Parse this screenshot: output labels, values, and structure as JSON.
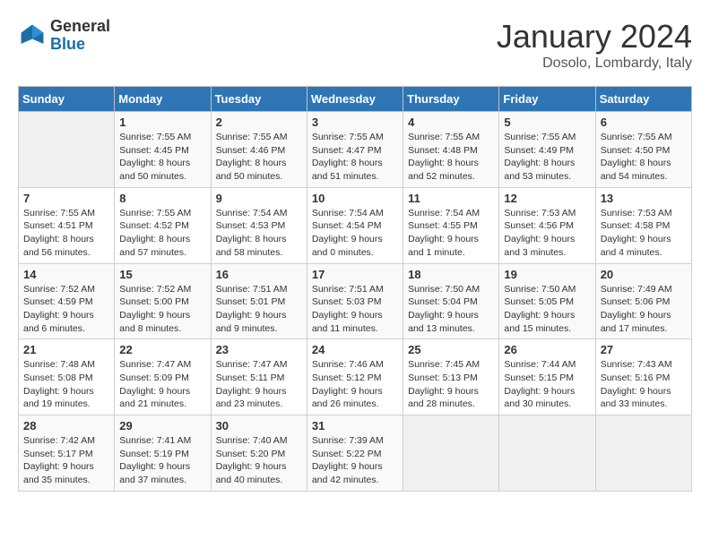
{
  "logo": {
    "general": "General",
    "blue": "Blue"
  },
  "header": {
    "title": "January 2024",
    "subtitle": "Dosolo, Lombardy, Italy"
  },
  "columns": [
    "Sunday",
    "Monday",
    "Tuesday",
    "Wednesday",
    "Thursday",
    "Friday",
    "Saturday"
  ],
  "weeks": [
    [
      {
        "day": "",
        "sunrise": "",
        "sunset": "",
        "daylight": ""
      },
      {
        "day": "1",
        "sunrise": "Sunrise: 7:55 AM",
        "sunset": "Sunset: 4:45 PM",
        "daylight": "Daylight: 8 hours and 50 minutes."
      },
      {
        "day": "2",
        "sunrise": "Sunrise: 7:55 AM",
        "sunset": "Sunset: 4:46 PM",
        "daylight": "Daylight: 8 hours and 50 minutes."
      },
      {
        "day": "3",
        "sunrise": "Sunrise: 7:55 AM",
        "sunset": "Sunset: 4:47 PM",
        "daylight": "Daylight: 8 hours and 51 minutes."
      },
      {
        "day": "4",
        "sunrise": "Sunrise: 7:55 AM",
        "sunset": "Sunset: 4:48 PM",
        "daylight": "Daylight: 8 hours and 52 minutes."
      },
      {
        "day": "5",
        "sunrise": "Sunrise: 7:55 AM",
        "sunset": "Sunset: 4:49 PM",
        "daylight": "Daylight: 8 hours and 53 minutes."
      },
      {
        "day": "6",
        "sunrise": "Sunrise: 7:55 AM",
        "sunset": "Sunset: 4:50 PM",
        "daylight": "Daylight: 8 hours and 54 minutes."
      }
    ],
    [
      {
        "day": "7",
        "sunrise": "Sunrise: 7:55 AM",
        "sunset": "Sunset: 4:51 PM",
        "daylight": "Daylight: 8 hours and 56 minutes."
      },
      {
        "day": "8",
        "sunrise": "Sunrise: 7:55 AM",
        "sunset": "Sunset: 4:52 PM",
        "daylight": "Daylight: 8 hours and 57 minutes."
      },
      {
        "day": "9",
        "sunrise": "Sunrise: 7:54 AM",
        "sunset": "Sunset: 4:53 PM",
        "daylight": "Daylight: 8 hours and 58 minutes."
      },
      {
        "day": "10",
        "sunrise": "Sunrise: 7:54 AM",
        "sunset": "Sunset: 4:54 PM",
        "daylight": "Daylight: 9 hours and 0 minutes."
      },
      {
        "day": "11",
        "sunrise": "Sunrise: 7:54 AM",
        "sunset": "Sunset: 4:55 PM",
        "daylight": "Daylight: 9 hours and 1 minute."
      },
      {
        "day": "12",
        "sunrise": "Sunrise: 7:53 AM",
        "sunset": "Sunset: 4:56 PM",
        "daylight": "Daylight: 9 hours and 3 minutes."
      },
      {
        "day": "13",
        "sunrise": "Sunrise: 7:53 AM",
        "sunset": "Sunset: 4:58 PM",
        "daylight": "Daylight: 9 hours and 4 minutes."
      }
    ],
    [
      {
        "day": "14",
        "sunrise": "Sunrise: 7:52 AM",
        "sunset": "Sunset: 4:59 PM",
        "daylight": "Daylight: 9 hours and 6 minutes."
      },
      {
        "day": "15",
        "sunrise": "Sunrise: 7:52 AM",
        "sunset": "Sunset: 5:00 PM",
        "daylight": "Daylight: 9 hours and 8 minutes."
      },
      {
        "day": "16",
        "sunrise": "Sunrise: 7:51 AM",
        "sunset": "Sunset: 5:01 PM",
        "daylight": "Daylight: 9 hours and 9 minutes."
      },
      {
        "day": "17",
        "sunrise": "Sunrise: 7:51 AM",
        "sunset": "Sunset: 5:03 PM",
        "daylight": "Daylight: 9 hours and 11 minutes."
      },
      {
        "day": "18",
        "sunrise": "Sunrise: 7:50 AM",
        "sunset": "Sunset: 5:04 PM",
        "daylight": "Daylight: 9 hours and 13 minutes."
      },
      {
        "day": "19",
        "sunrise": "Sunrise: 7:50 AM",
        "sunset": "Sunset: 5:05 PM",
        "daylight": "Daylight: 9 hours and 15 minutes."
      },
      {
        "day": "20",
        "sunrise": "Sunrise: 7:49 AM",
        "sunset": "Sunset: 5:06 PM",
        "daylight": "Daylight: 9 hours and 17 minutes."
      }
    ],
    [
      {
        "day": "21",
        "sunrise": "Sunrise: 7:48 AM",
        "sunset": "Sunset: 5:08 PM",
        "daylight": "Daylight: 9 hours and 19 minutes."
      },
      {
        "day": "22",
        "sunrise": "Sunrise: 7:47 AM",
        "sunset": "Sunset: 5:09 PM",
        "daylight": "Daylight: 9 hours and 21 minutes."
      },
      {
        "day": "23",
        "sunrise": "Sunrise: 7:47 AM",
        "sunset": "Sunset: 5:11 PM",
        "daylight": "Daylight: 9 hours and 23 minutes."
      },
      {
        "day": "24",
        "sunrise": "Sunrise: 7:46 AM",
        "sunset": "Sunset: 5:12 PM",
        "daylight": "Daylight: 9 hours and 26 minutes."
      },
      {
        "day": "25",
        "sunrise": "Sunrise: 7:45 AM",
        "sunset": "Sunset: 5:13 PM",
        "daylight": "Daylight: 9 hours and 28 minutes."
      },
      {
        "day": "26",
        "sunrise": "Sunrise: 7:44 AM",
        "sunset": "Sunset: 5:15 PM",
        "daylight": "Daylight: 9 hours and 30 minutes."
      },
      {
        "day": "27",
        "sunrise": "Sunrise: 7:43 AM",
        "sunset": "Sunset: 5:16 PM",
        "daylight": "Daylight: 9 hours and 33 minutes."
      }
    ],
    [
      {
        "day": "28",
        "sunrise": "Sunrise: 7:42 AM",
        "sunset": "Sunset: 5:17 PM",
        "daylight": "Daylight: 9 hours and 35 minutes."
      },
      {
        "day": "29",
        "sunrise": "Sunrise: 7:41 AM",
        "sunset": "Sunset: 5:19 PM",
        "daylight": "Daylight: 9 hours and 37 minutes."
      },
      {
        "day": "30",
        "sunrise": "Sunrise: 7:40 AM",
        "sunset": "Sunset: 5:20 PM",
        "daylight": "Daylight: 9 hours and 40 minutes."
      },
      {
        "day": "31",
        "sunrise": "Sunrise: 7:39 AM",
        "sunset": "Sunset: 5:22 PM",
        "daylight": "Daylight: 9 hours and 42 minutes."
      },
      {
        "day": "",
        "sunrise": "",
        "sunset": "",
        "daylight": ""
      },
      {
        "day": "",
        "sunrise": "",
        "sunset": "",
        "daylight": ""
      },
      {
        "day": "",
        "sunrise": "",
        "sunset": "",
        "daylight": ""
      }
    ]
  ]
}
